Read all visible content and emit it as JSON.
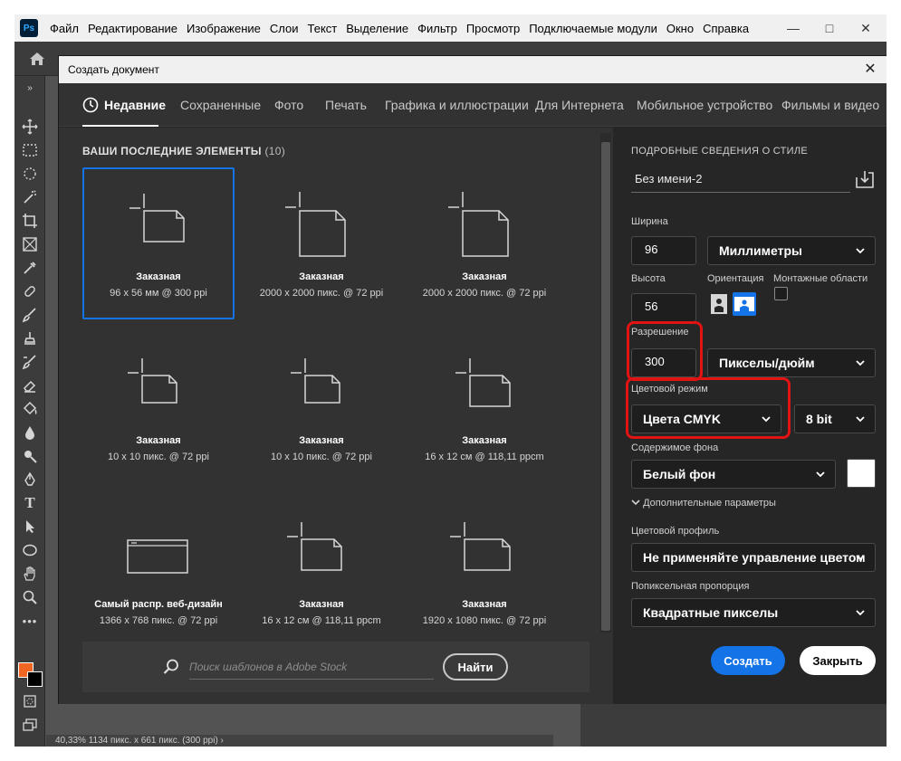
{
  "app": {
    "logo": "Ps",
    "menu": [
      "Файл",
      "Редактирование",
      "Изображение",
      "Слои",
      "Текст",
      "Выделение",
      "Фильтр",
      "Просмотр",
      "Подключаемые модули",
      "Окно",
      "Справка"
    ],
    "status_text": "40,33%   1134 пикс. x 661 пикс. (300 ppi)   ›",
    "accent_color": "#1473e6"
  },
  "dialog": {
    "title": "Создать документ",
    "tabs": [
      "Недавние",
      "Сохраненные",
      "Фото",
      "Печать",
      "Графика и иллюстрации",
      "Для Интернета",
      "Мобильное устройство",
      "Фильмы и видео"
    ],
    "active_tab": "Недавние"
  },
  "recent": {
    "heading": "ВАШИ ПОСЛЕДНИЕ ЭЛЕМЕНТЫ",
    "count": "(10)",
    "presets": [
      {
        "name": "Заказная",
        "desc": "96 x 56 мм @ 300 ppi",
        "icon": "landscape-doc-icon",
        "selected": true
      },
      {
        "name": "Заказная",
        "desc": "2000 x 2000 пикс. @ 72 ppi",
        "icon": "square-doc-icon"
      },
      {
        "name": "Заказная",
        "desc": "2000 x 2000 пикс. @ 72 ppi",
        "icon": "square-doc-icon"
      },
      {
        "name": "Заказная",
        "desc": "10 x 10 пикс. @ 72 ppi",
        "icon": "square-doc-icon"
      },
      {
        "name": "Заказная",
        "desc": "10 x 10 пикс. @ 72 ppi",
        "icon": "square-doc-icon"
      },
      {
        "name": "Заказная",
        "desc": "16 x 12 см @ 118,11 ppcm",
        "icon": "landscape-doc-icon"
      },
      {
        "name": "Самый распр. веб-дизайн",
        "desc": "1366 x 768 пикс. @ 72 ppi",
        "icon": "browser-window-icon"
      },
      {
        "name": "Заказная",
        "desc": "16 x 12 см @ 118,11 ppcm",
        "icon": "landscape-doc-icon"
      },
      {
        "name": "Заказная",
        "desc": "1920 x 1080 пикс. @ 72 ppi",
        "icon": "landscape-doc-icon"
      }
    ]
  },
  "search": {
    "placeholder": "Поиск шаблонов в Adobe Stock",
    "button": "Найти"
  },
  "details": {
    "heading": "ПОДРОБНЫЕ СВЕДЕНИЯ О СТИЛЕ",
    "doc_name": "Без имени-2",
    "width_label": "Ширина",
    "width_value": "96",
    "width_unit": "Миллиметры",
    "height_label": "Высота",
    "height_value": "56",
    "orientation_label": "Ориентация",
    "artboards_label": "Монтажные области",
    "resolution_label": "Разрешение",
    "resolution_value": "300",
    "resolution_unit": "Пикселы/дюйм",
    "color_mode_label": "Цветовой режим",
    "color_mode": "Цвета CMYK",
    "bit_depth": "8 bit",
    "bg_label": "Содержимое фона",
    "bg_value": "Белый фон",
    "bg_color": "#ffffff",
    "advanced_label": "Дополнительные параметры",
    "profile_label": "Цветовой профиль",
    "profile_value": "Не применяйте управление цветом",
    "pixel_aspect_label": "Попиксельная пропорция",
    "pixel_aspect_value": "Квадратные пикселы",
    "create_button": "Создать",
    "close_button": "Закрыть",
    "highlight_color": "#e11313"
  }
}
